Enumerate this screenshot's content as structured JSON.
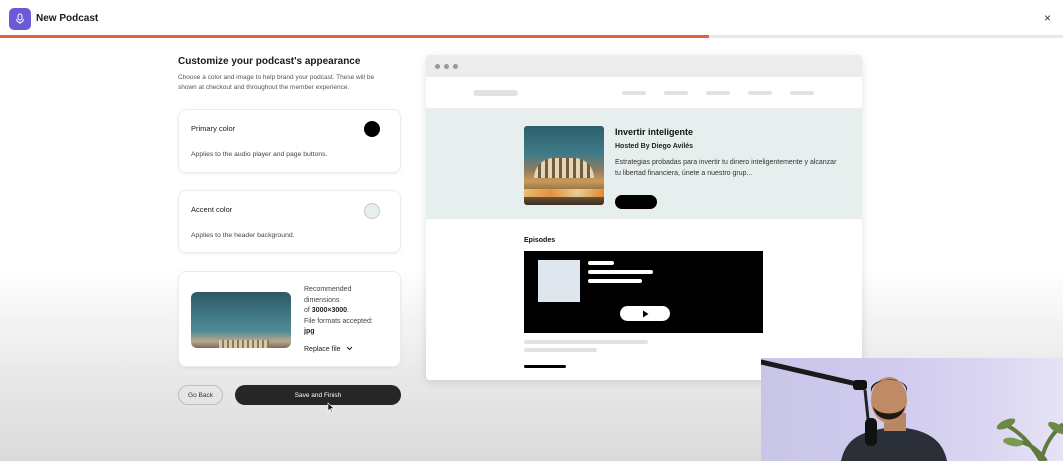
{
  "header": {
    "title": "New Podcast",
    "close_label": "×"
  },
  "progress": {
    "fraction": 0.667
  },
  "customize": {
    "title": "Customize your podcast's appearance",
    "description": "Choose a color and image to help brand your podcast. These will be shown at checkout and throughout the member experience."
  },
  "primary_color": {
    "label": "Primary color",
    "help": "Applies to the audio player and page buttons.",
    "value": "#000000"
  },
  "accent_color": {
    "label": "Accent color",
    "help": "Applies to the header background.",
    "value": "#e7eeee"
  },
  "image": {
    "info_line1": "Recommended",
    "info_line2": "dimensions",
    "info_line3_prefix": "of ",
    "info_dimensions": "3000×3000",
    "info_line3_suffix": ".",
    "info_line4": "File formats accepted:",
    "info_formats": "jpg",
    "replace_label": "Replace file"
  },
  "actions": {
    "back_label": "Go Back",
    "save_label": "Save and Finish"
  },
  "preview": {
    "podcast_title": "Invertir inteligente",
    "host": "Hosted By Diego Avilés",
    "description": "Estrategias probadas para invertir tu dinero inteligentemente y alcanzar tu libertad financiera, únete a nuestro grup...",
    "episodes_label": "Episodes"
  },
  "icons": {
    "app": "microphone-icon",
    "close": "close-icon",
    "replace": "chevron-down-icon",
    "play": "play-icon",
    "cursor": "mouse-cursor-icon"
  },
  "colors": {
    "brand": "#6b5ad8",
    "progress": "#e5603a"
  }
}
